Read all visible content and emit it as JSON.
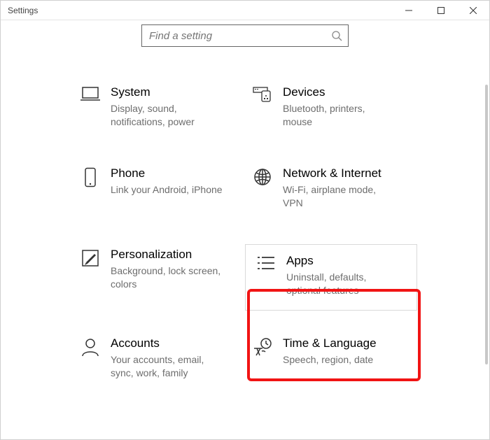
{
  "window": {
    "title": "Settings"
  },
  "search": {
    "placeholder": "Find a setting"
  },
  "tiles": {
    "system": {
      "label": "System",
      "desc": "Display, sound, notifications, power"
    },
    "devices": {
      "label": "Devices",
      "desc": "Bluetooth, printers, mouse"
    },
    "phone": {
      "label": "Phone",
      "desc": "Link your Android, iPhone"
    },
    "network": {
      "label": "Network & Internet",
      "desc": "Wi-Fi, airplane mode, VPN"
    },
    "personalization": {
      "label": "Personalization",
      "desc": "Background, lock screen, colors"
    },
    "apps": {
      "label": "Apps",
      "desc": "Uninstall, defaults, optional features"
    },
    "accounts": {
      "label": "Accounts",
      "desc": "Your accounts, email, sync, work, family"
    },
    "time": {
      "label": "Time & Language",
      "desc": "Speech, region, date"
    }
  },
  "colors": {
    "highlight": "#f11414"
  }
}
